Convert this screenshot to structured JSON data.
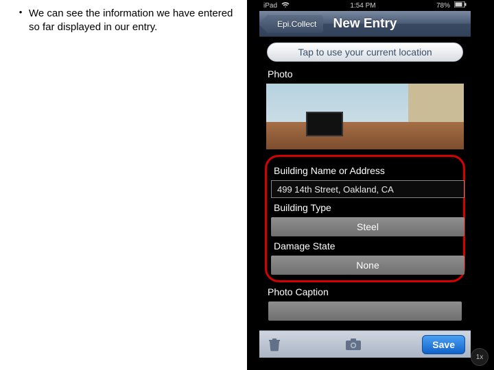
{
  "slide": {
    "bullet": "We can see the information we have entered so far displayed in our entry."
  },
  "statusbar": {
    "device": "iPad",
    "wifi_icon": "wifi",
    "time": "1:54 PM",
    "battery": "78%"
  },
  "nav": {
    "back_label": "Epi.Collect",
    "title": "New Entry"
  },
  "location_button": "Tap to use your current location",
  "fields": {
    "photo_label": "Photo",
    "name_label": "Building Name or Address",
    "name_value": "499 14th Street, Oakland, CA",
    "type_label": "Building Type",
    "type_value": "Steel",
    "damage_label": "Damage State",
    "damage_value": "None",
    "caption_label": "Photo Caption"
  },
  "toolbar": {
    "trash_icon": "trash",
    "camera_icon": "camera",
    "save_label": "Save"
  },
  "zoom": "1x"
}
